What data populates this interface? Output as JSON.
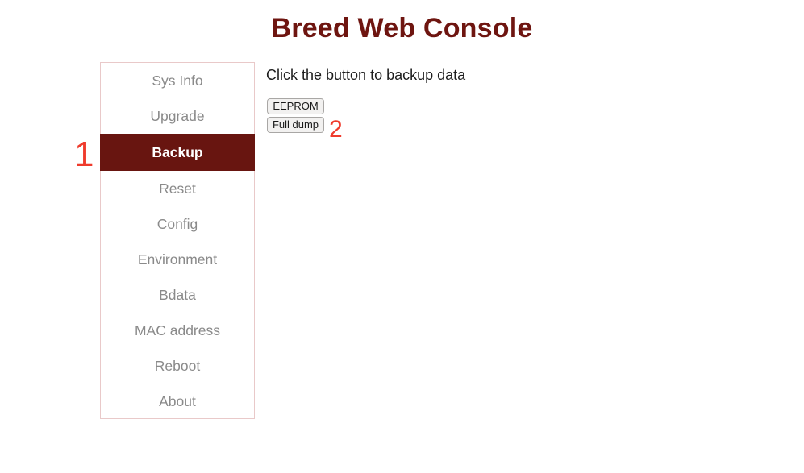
{
  "page": {
    "title": "Breed Web Console",
    "accent_maroon": "#681510",
    "title_color": "#6e1510",
    "sidebar_border_color": "#e9c9c9",
    "annotation_color": "#ef3b2c",
    "background": "#ffffff"
  },
  "sidebar": {
    "active_index": 2,
    "items": [
      {
        "label": "Sys Info",
        "active": false
      },
      {
        "label": "Upgrade",
        "active": false
      },
      {
        "label": "Backup",
        "active": true
      },
      {
        "label": "Reset",
        "active": false
      },
      {
        "label": "Config",
        "active": false
      },
      {
        "label": "Environment",
        "active": false
      },
      {
        "label": "Bdata",
        "active": false
      },
      {
        "label": "MAC address",
        "active": false
      },
      {
        "label": "Reboot",
        "active": false
      },
      {
        "label": "About",
        "active": false
      }
    ]
  },
  "main": {
    "heading": "Click the button to backup data",
    "buttons": [
      {
        "label": "EEPROM"
      },
      {
        "label": "Full dump"
      }
    ]
  },
  "annotations": [
    {
      "label": "1",
      "target": "sidebar-item-backup"
    },
    {
      "label": "2",
      "target": "full-dump-button"
    }
  ]
}
